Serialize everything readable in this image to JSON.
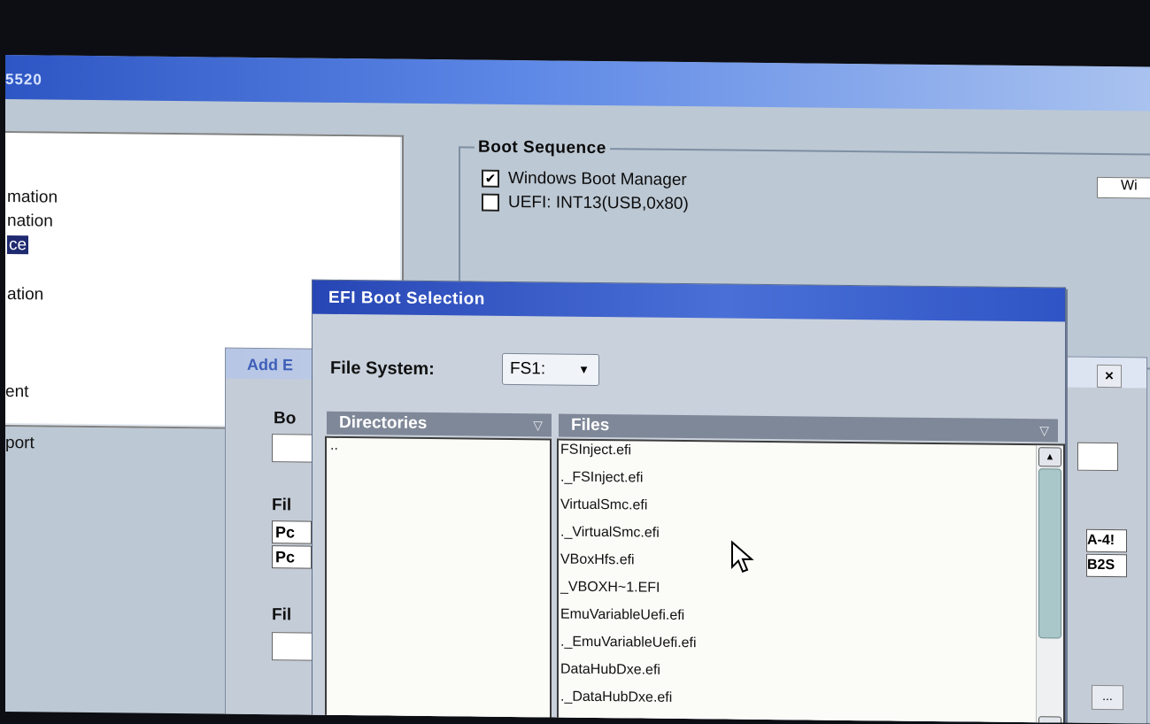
{
  "app": {
    "title_fragment": "5520"
  },
  "left_pane": {
    "items": [
      {
        "label": "mation"
      },
      {
        "label": "nation"
      },
      {
        "label": "ce",
        "selected": true
      },
      {
        "label": "ation"
      }
    ],
    "lower_items": [
      {
        "label": "ent"
      },
      {
        "label": "port"
      }
    ]
  },
  "boot_sequence": {
    "title": "Boot Sequence",
    "entries": [
      {
        "label": "Windows Boot Manager",
        "checked": true
      },
      {
        "label": "UEFI: INT13(USB,0x80)",
        "checked": false
      }
    ],
    "right_field_value": "Wi"
  },
  "add_dialog": {
    "title_fragment": "Add E",
    "close_label": "×",
    "labels": {
      "boot": "Bo",
      "file": "Fil",
      "file2": "Fil"
    },
    "pc_values": [
      "Pc",
      "Pc"
    ],
    "right_values": [
      "A-4!",
      "B2S"
    ],
    "browse_label": "..."
  },
  "efi_dialog": {
    "title": "EFI Boot Selection",
    "file_system_label": "File System:",
    "file_system_value": "FS1:",
    "directories_header": "Directories",
    "files_header": "Files",
    "directories": [
      ".."
    ],
    "files": [
      "FSInject.efi",
      "._FSInject.efi",
      "VirtualSmc.efi",
      "._VirtualSmc.efi",
      "VBoxHfs.efi",
      "_VBOXH~1.EFI",
      "EmuVariableUefi.efi",
      "._EmuVariableUefi.efi",
      "DataHubDxe.efi",
      "._DataHubDxe.efi"
    ]
  },
  "colors": {
    "title_blue": "#2746b5",
    "selection": "#1f2a70",
    "window_bg": "#bcc8d4"
  }
}
